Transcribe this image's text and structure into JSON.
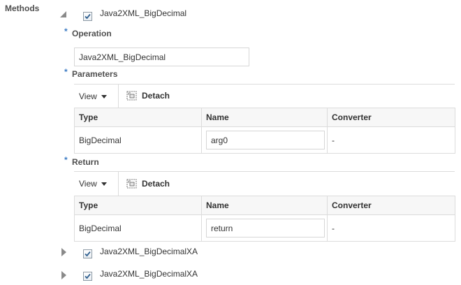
{
  "section": {
    "label": "Methods"
  },
  "methods": [
    {
      "name": "Java2XML_BigDecimal",
      "checked": true,
      "expanded": true
    },
    {
      "name": "Java2XML_BigDecimalXA",
      "checked": true,
      "expanded": false
    },
    {
      "name": "Java2XML_BigDecimalXA",
      "checked": true,
      "expanded": false
    }
  ],
  "operation": {
    "required_marker": "*",
    "label": "Operation",
    "value": "Java2XML_BigDecimal"
  },
  "parameters": {
    "required_marker": "*",
    "label": "Parameters",
    "toolbar": {
      "view_label": "View",
      "detach_label": "Detach"
    },
    "columns": [
      "Type",
      "Name",
      "Converter"
    ],
    "rows": [
      {
        "type": "BigDecimal",
        "name": "arg0",
        "converter": "-"
      }
    ]
  },
  "return": {
    "required_marker": "*",
    "label": "Return",
    "toolbar": {
      "view_label": "View",
      "detach_label": "Detach"
    },
    "columns": [
      "Type",
      "Name",
      "Converter"
    ],
    "rows": [
      {
        "type": "BigDecimal",
        "name": "return",
        "converter": "-"
      }
    ]
  },
  "colors": {
    "required_star": "#3c7bc4",
    "border": "#dcdcdc",
    "label_text": "#4f4f4f"
  }
}
